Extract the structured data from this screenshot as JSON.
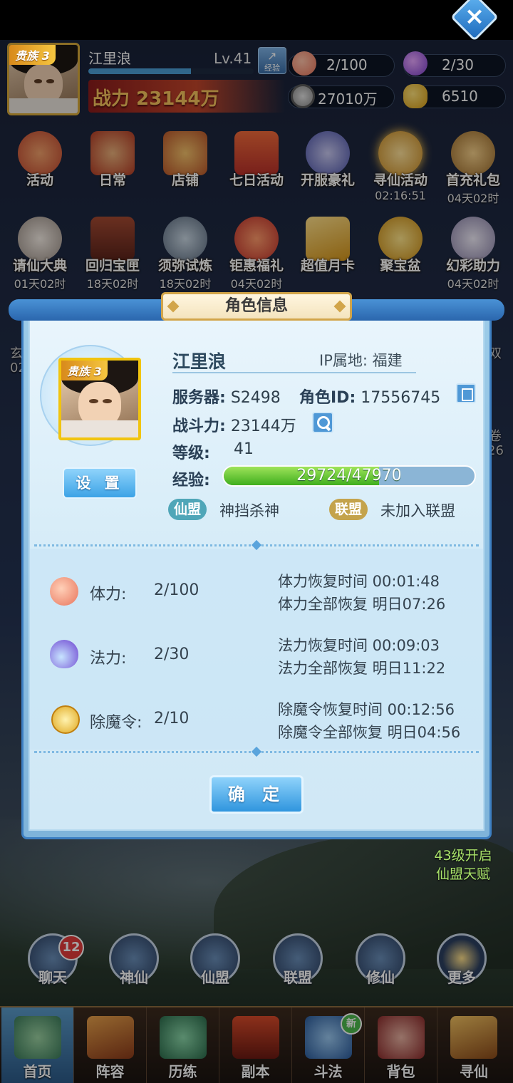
{
  "header": {
    "vip_tag": "贵族 3",
    "player_name": "江里浪",
    "level": "Lv.41",
    "exp_button_label": "经验",
    "top_exp_fill": 0.62,
    "power": "战力 23144万",
    "resources": {
      "stamina": "2/100",
      "mana": "2/30",
      "coins": "27010万",
      "gold": "6510"
    }
  },
  "activities_row1": [
    {
      "label": "活动",
      "timer": "",
      "icon": "drum-icon",
      "color": "#d25a3a"
    },
    {
      "label": "日常",
      "timer": "",
      "icon": "scroll-icon",
      "color": "#c0462e"
    },
    {
      "label": "店铺",
      "timer": "",
      "icon": "shop-icon",
      "color": "#c87a2a"
    },
    {
      "label": "七日活动",
      "timer": "",
      "icon": "calendar-icon",
      "color": "#d84a2a"
    },
    {
      "label": "开服豪礼",
      "timer": "",
      "icon": "character-icon",
      "color": "#5a62b8"
    },
    {
      "label": "寻仙活动",
      "timer": "02:16:51",
      "icon": "lantern-icon",
      "color": "#d8a43a"
    },
    {
      "label": "首充礼包",
      "timer": "04天02时",
      "icon": "gift-bag-icon",
      "color": "#b88a3a"
    }
  ],
  "activities_row2": [
    {
      "label": "请仙大典",
      "timer": "01天02时",
      "icon": "immortal-icon",
      "color": "#cfc3b8"
    },
    {
      "label": "回归宝匣",
      "timer": "18天02时",
      "icon": "chest-icon",
      "color": "#8a3a2a"
    },
    {
      "label": "须弥试炼",
      "timer": "18天02时",
      "icon": "pagoda-icon",
      "color": "#7e8ea0"
    },
    {
      "label": "钜惠福礼",
      "timer": "04天02时",
      "icon": "money-bag-icon",
      "color": "#d24a2a"
    },
    {
      "label": "超值月卡",
      "timer": "",
      "icon": "month-card-icon",
      "color": "#e0b440"
    },
    {
      "label": "聚宝盆",
      "timer": "",
      "icon": "treasure-bowl-icon",
      "color": "#e6b030"
    },
    {
      "label": "幻彩助力",
      "timer": "04天02时",
      "icon": "fairy-icon",
      "color": "#c8c0d8"
    }
  ],
  "dialog": {
    "title": "角色信息",
    "vip_tag": "贵族 3",
    "name": "江里浪",
    "ip_label": "IP属地:",
    "ip_value": "福建",
    "server_label": "服务器:",
    "server_value": "S2498",
    "role_id_label": "角色ID:",
    "role_id_value": "17556745",
    "combat_label": "战斗力:",
    "combat_value": "23144万",
    "level_label": "等级:",
    "level_value": "41",
    "exp_label": "经验:",
    "exp_value": "29724/47970",
    "exp_fraction": 0.62,
    "settings_button": "设 置",
    "guild_tag": "仙盟",
    "guild_value": "神挡杀神",
    "alliance_tag": "联盟",
    "alliance_value": "未加入联盟",
    "recoveries": [
      {
        "icon": "peach-icon",
        "label": "体力:",
        "value": "2/100",
        "line1": "体力恢复时间 00:01:48",
        "line2": "体力全部恢复 明日07:26"
      },
      {
        "icon": "flame-icon",
        "label": "法力:",
        "value": "2/30",
        "line1": "法力恢复时间 00:09:03",
        "line2": "法力全部恢复 明日11:22"
      },
      {
        "icon": "token-icon",
        "label": "除魔令:",
        "value": "2/10",
        "line1": "除魔令恢复时间 00:12:56",
        "line2": "除魔令全部恢复 明日04:56"
      }
    ],
    "confirm_button": "确 定"
  },
  "behind": {
    "left_peek_1": "玄",
    "left_peek_2": "02",
    "right_peek_1": "卷",
    "right_peek_2": "26",
    "right_peek_3": "双",
    "unlock_line1": "43级开启",
    "unlock_line2": "仙盟天赋"
  },
  "mid_nav": [
    {
      "label": "聊天",
      "icon": "chat-icon"
    },
    {
      "label": "神仙",
      "icon": "immortal-icon"
    },
    {
      "label": "仙盟",
      "icon": "guild-book-icon"
    },
    {
      "label": "联盟",
      "icon": "dragon-shield-icon"
    },
    {
      "label": "修仙",
      "icon": "crane-icon"
    },
    {
      "label": "更多",
      "icon": "more-flower-icon"
    }
  ],
  "chat_badge": "12",
  "bottom_nav": [
    {
      "label": "首页",
      "icon": "home-icon",
      "active": true
    },
    {
      "label": "阵容",
      "icon": "cards-icon",
      "active": false
    },
    {
      "label": "历练",
      "icon": "gourd-icon",
      "active": false
    },
    {
      "label": "副本",
      "icon": "gate-icon",
      "active": false
    },
    {
      "label": "斗法",
      "icon": "swords-icon",
      "active": false
    },
    {
      "label": "背包",
      "icon": "bag-icon",
      "active": false
    },
    {
      "label": "寻仙",
      "icon": "scroll-seek-icon",
      "active": false
    }
  ],
  "new_badge": "新"
}
